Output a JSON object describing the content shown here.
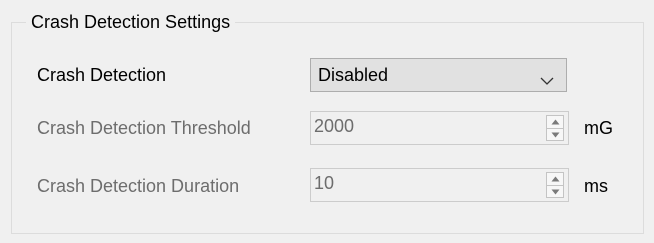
{
  "group": {
    "title": "Crash Detection Settings"
  },
  "crash_detection": {
    "label": "Crash Detection",
    "selected": "Disabled",
    "arrow_icon": "chevron-down-icon"
  },
  "threshold": {
    "label": "Crash Detection Threshold",
    "value": "2000",
    "unit": "mG"
  },
  "duration": {
    "label": "Crash Detection Duration",
    "value": "10",
    "unit": "ms"
  },
  "colors": {
    "window_bg": "#f0f0f0",
    "disabled_text": "#6d6d6d",
    "combo_bg": "#e1e1e1",
    "border": "#adadad"
  }
}
